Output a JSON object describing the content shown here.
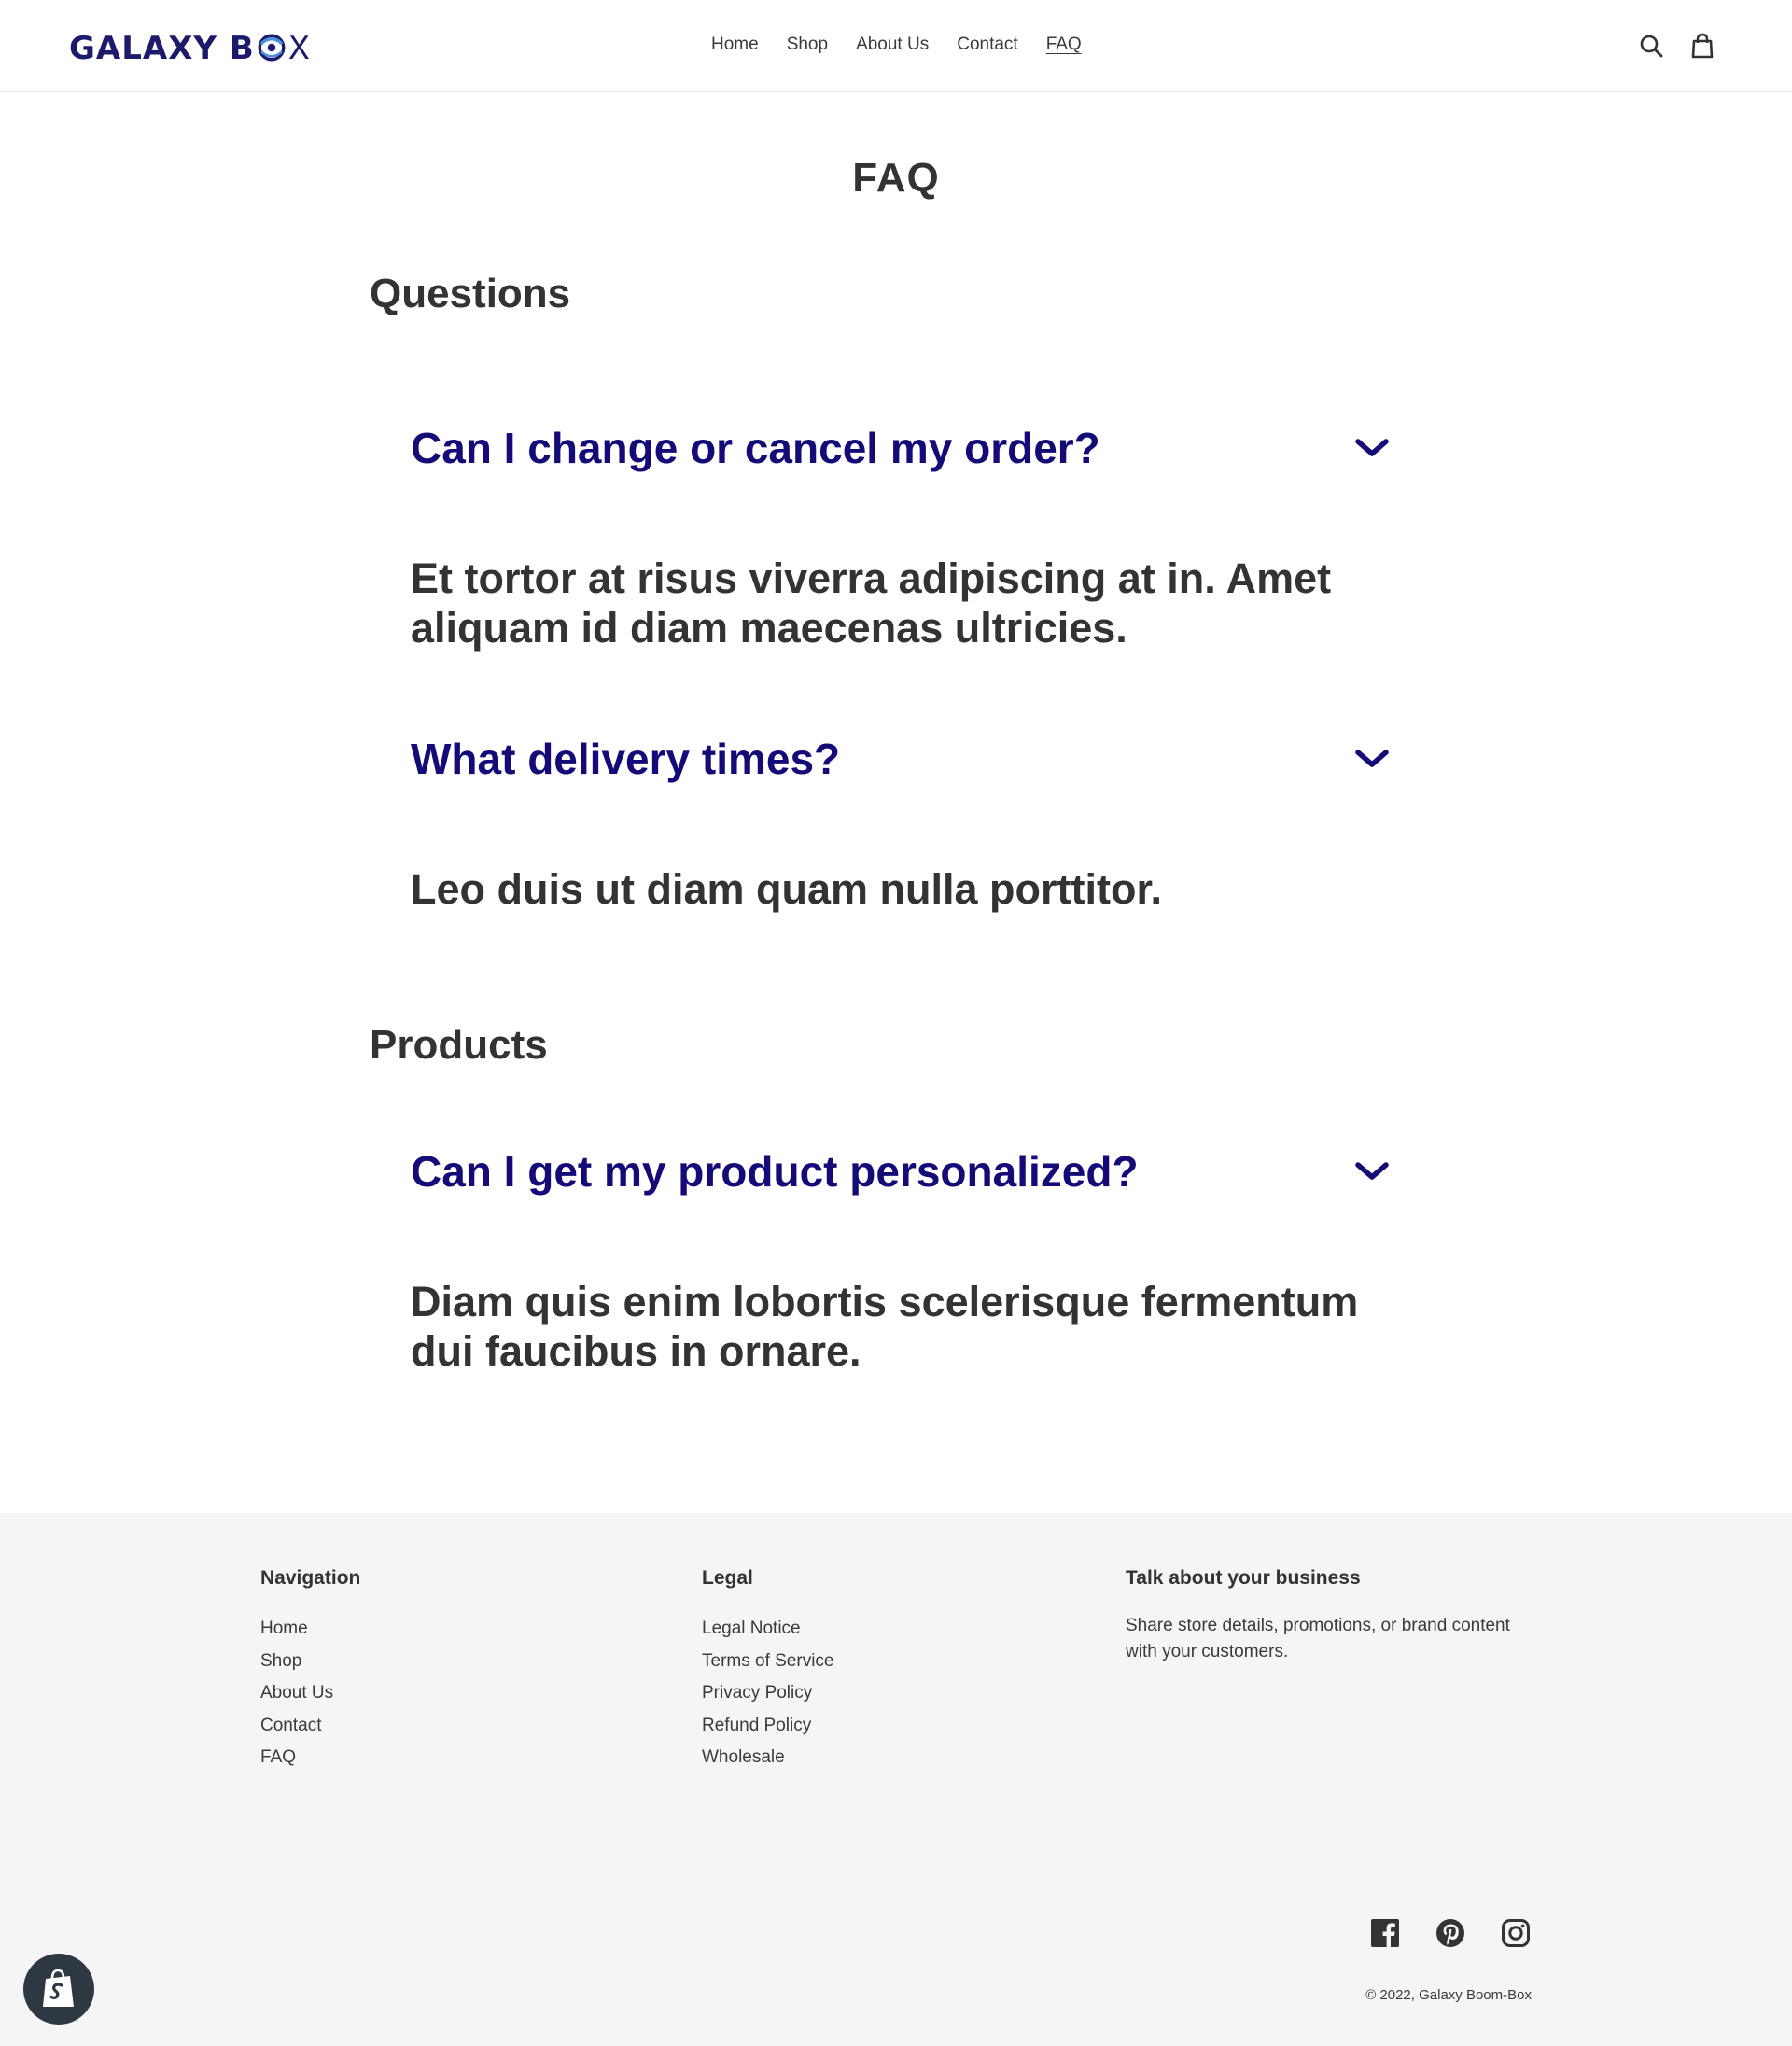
{
  "brand": {
    "logo_left": "GALAXY B",
    "logo_right": "X",
    "logo_color": "#1c1a6b"
  },
  "header": {
    "nav": [
      "Home",
      "Shop",
      "About Us",
      "Contact",
      "FAQ"
    ],
    "active_nav": "FAQ",
    "icons": [
      "search-icon",
      "cart-icon"
    ]
  },
  "main": {
    "title": "FAQ",
    "sections": [
      {
        "heading": "Questions",
        "items": [
          {
            "question": "Can I change or cancel my order?",
            "answer": "Et tortor at risus viverra adipiscing at in. Amet aliquam id diam maecenas ultricies."
          },
          {
            "question": "What delivery times?",
            "answer": "Leo duis ut diam quam nulla porttitor."
          }
        ]
      },
      {
        "heading": "Products",
        "items": [
          {
            "question": "Can I get my product personalized?",
            "answer": "Diam quis enim lobortis scelerisque fermentum dui faucibus in ornare."
          }
        ]
      }
    ],
    "question_color": "#140a78"
  },
  "footer": {
    "navigation": {
      "heading": "Navigation",
      "links": [
        "Home",
        "Shop",
        "About Us",
        "Contact",
        "FAQ"
      ]
    },
    "legal": {
      "heading": "Legal",
      "links": [
        "Legal Notice",
        "Terms of Service",
        "Privacy Policy",
        "Refund Policy",
        "Wholesale"
      ]
    },
    "about": {
      "heading": "Talk about your business",
      "text": "Share store details, promotions, or brand content with your customers."
    },
    "social_icons": [
      "facebook-icon",
      "pinterest-icon",
      "instagram-icon"
    ],
    "copyright": "© 2022, Galaxy Boom-Box"
  }
}
